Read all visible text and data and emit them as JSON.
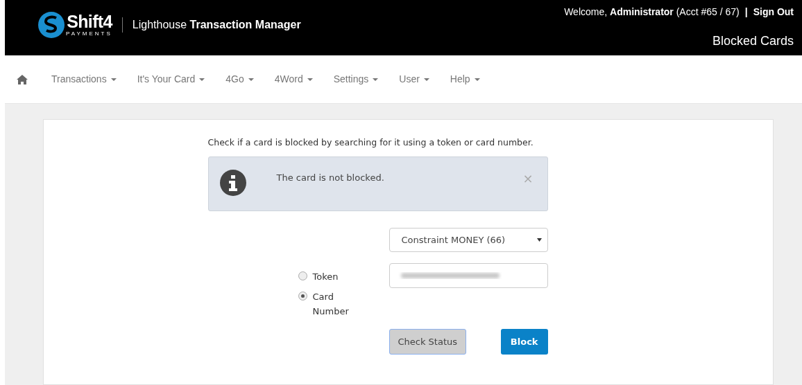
{
  "header": {
    "brand": "Shift4",
    "brand_sub": "PAYMENTS",
    "app_title": "Lighthouse **Transaction Manager**",
    "welcome": "Welcome, **Administrator** (Acct #65 / 67)",
    "separator": "|",
    "sign_out": "Sign Out",
    "page_title": "Blocked Cards"
  },
  "nav": {
    "items": [
      {
        "label": "Transactions"
      },
      {
        "label": "It's Your Card"
      },
      {
        "label": "4Go"
      },
      {
        "label": "4Word"
      },
      {
        "label": "Settings"
      },
      {
        "label": "User"
      },
      {
        "label": "Help"
      }
    ]
  },
  "content": {
    "intro": "Check if a card is blocked by searching for it using a token or card number.",
    "alert": {
      "message": "The card is not blocked.",
      "close": "×"
    },
    "select": {
      "value": "Constraint MONEY (66)"
    },
    "search_type": [
      {
        "label": "Token",
        "selected": false
      },
      {
        "label": "Card Number",
        "selected": true
      }
    ],
    "buttons": [
      {
        "label": "Check Status",
        "kind": "secondary"
      },
      {
        "label": "Block",
        "kind": "primary"
      }
    ]
  }
}
